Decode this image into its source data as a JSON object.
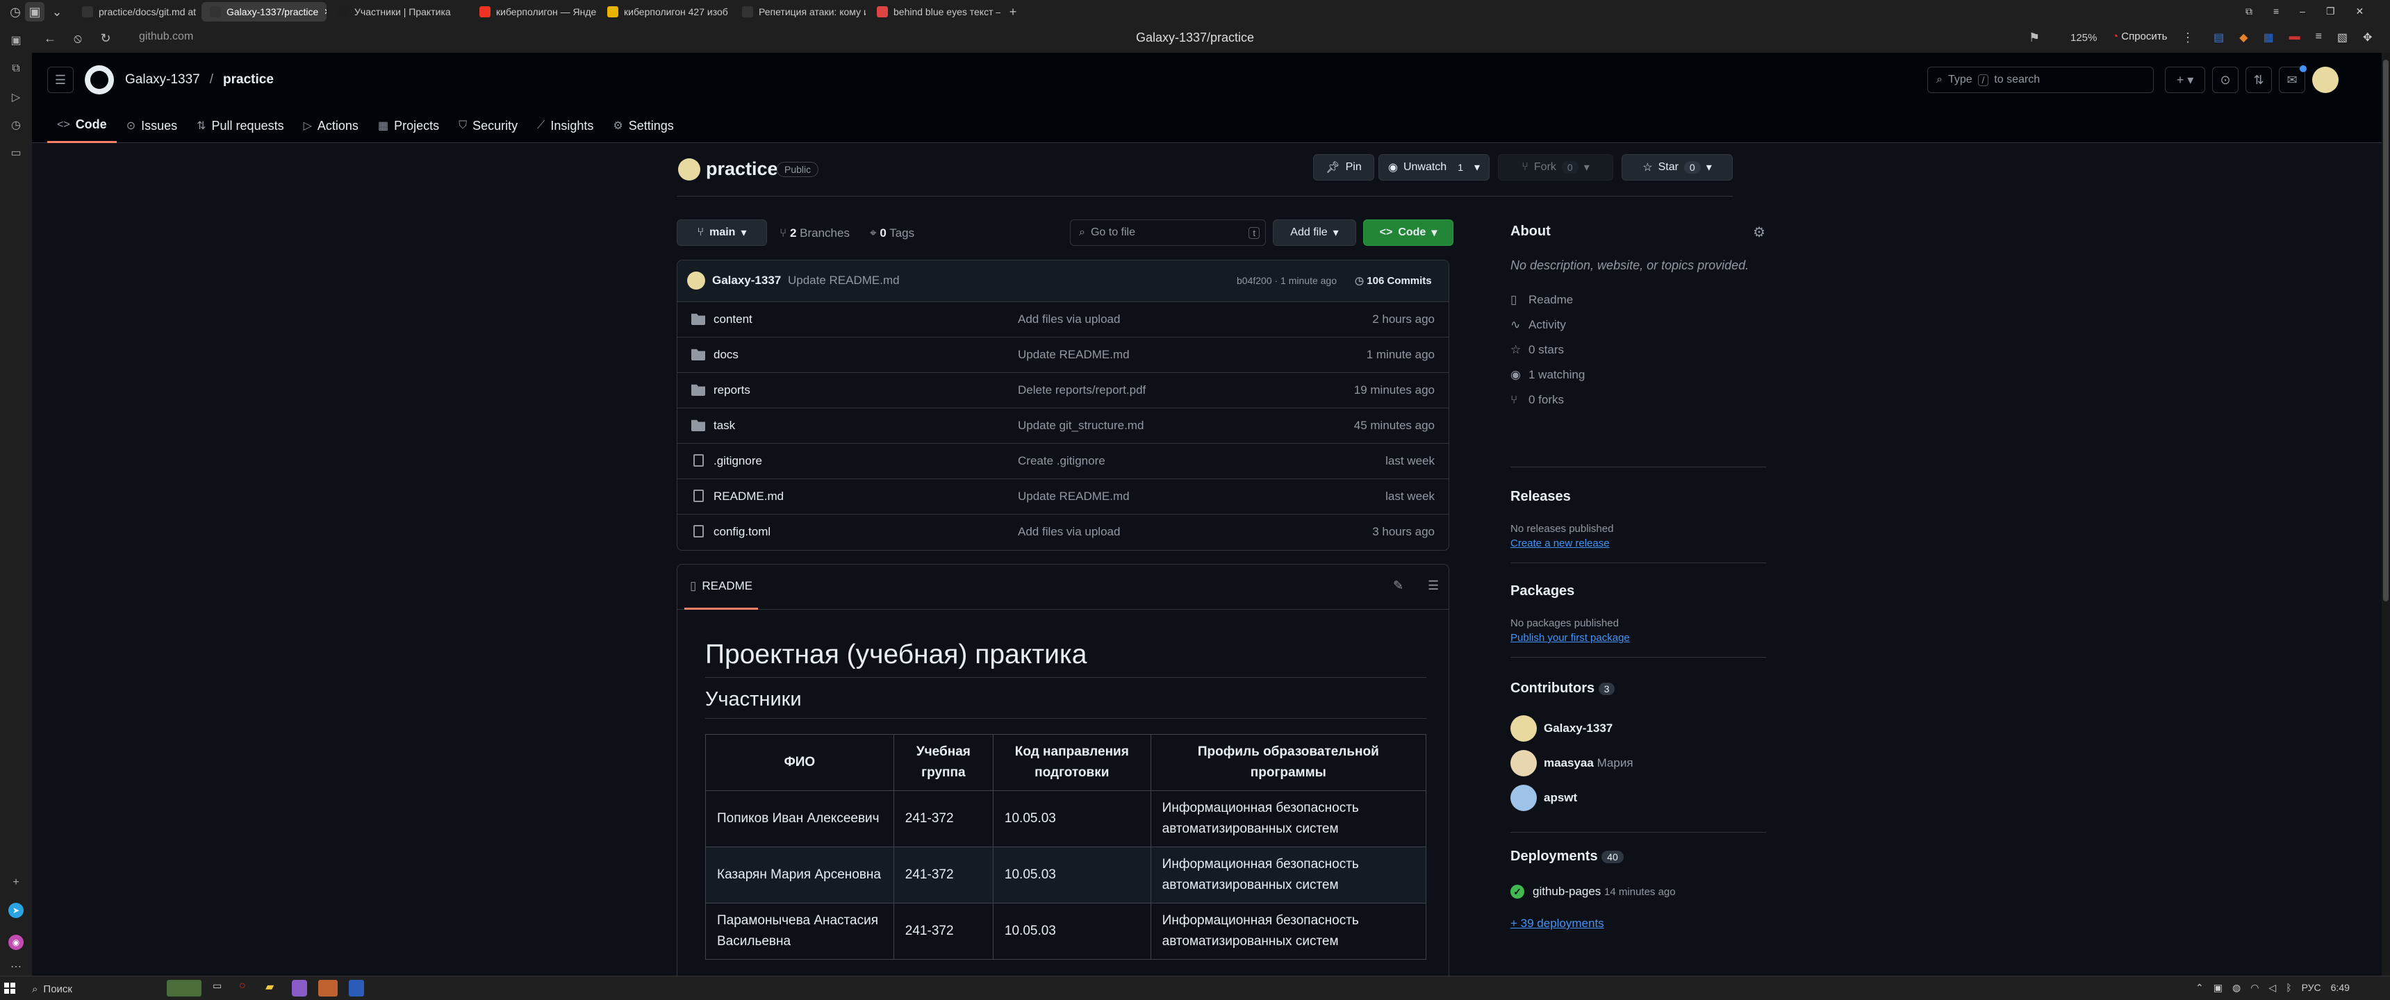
{
  "browser": {
    "tabs": [
      {
        "label": "practice/docs/git.md at m",
        "color": "#333"
      },
      {
        "label": "Galaxy-1337/practice",
        "color": "#333",
        "active": true
      },
      {
        "label": "Участники | Практика",
        "color": "#1e1e1e"
      },
      {
        "label": "киберполигон — Яндекс",
        "color": "#e32"
      },
      {
        "label": "киберполигон 427 изоб",
        "color": "#e9b400"
      },
      {
        "label": "Репетиция атаки: кому и",
        "color": "#333"
      },
      {
        "label": "behind blue eyes текст —",
        "color": "#d44"
      }
    ],
    "url": "github.com",
    "page_title": "Galaxy-1337/practice",
    "zoom": "125%",
    "ask_label": "Спросить"
  },
  "header": {
    "owner": "Galaxy-1337",
    "sep": "/",
    "repo": "practice",
    "search_placeholder": "Type / to search",
    "search_type": "Type",
    "search_key": "/",
    "search_rest": "to search"
  },
  "repo_nav": [
    {
      "label": "Code",
      "icon": "code-icon",
      "active": true
    },
    {
      "label": "Issues",
      "icon": "issue-icon"
    },
    {
      "label": "Pull requests",
      "icon": "pull-request-icon"
    },
    {
      "label": "Actions",
      "icon": "actions-icon"
    },
    {
      "label": "Projects",
      "icon": "projects-icon"
    },
    {
      "label": "Security",
      "icon": "shield-icon"
    },
    {
      "label": "Insights",
      "icon": "graph-icon"
    },
    {
      "label": "Settings",
      "icon": "gear-icon"
    }
  ],
  "repo": {
    "name": "practice",
    "visibility": "Public",
    "pin": "Pin",
    "unwatch": "Unwatch",
    "watch_count": "1",
    "fork": "Fork",
    "fork_count": "0",
    "star": "Star",
    "star_count": "0"
  },
  "toolbar": {
    "branch": "main",
    "branches_count": "2",
    "branches_label": "Branches",
    "tags_count": "0",
    "tags_label": "Tags",
    "goto_placeholder": "Go to file",
    "goto_key": "t",
    "add_file": "Add file",
    "code": "Code"
  },
  "commit": {
    "author": "Galaxy-1337",
    "message": "Update README.md",
    "hash_time": "b04f200 · 1 minute ago",
    "commits": "106 Commits"
  },
  "files": [
    {
      "name": "content",
      "type": "dir",
      "message": "Add files via upload",
      "time": "2 hours ago"
    },
    {
      "name": "docs",
      "type": "dir",
      "message": "Update README.md",
      "time": "1 minute ago"
    },
    {
      "name": "reports",
      "type": "dir",
      "message": "Delete reports/report.pdf",
      "time": "19 minutes ago"
    },
    {
      "name": "task",
      "type": "dir",
      "message": "Update git_structure.md",
      "time": "45 minutes ago"
    },
    {
      "name": ".gitignore",
      "type": "file",
      "message": "Create .gitignore",
      "time": "last week"
    },
    {
      "name": "README.md",
      "type": "file",
      "message": "Update README.md",
      "time": "last week"
    },
    {
      "name": "config.toml",
      "type": "file",
      "message": "Add files via upload",
      "time": "3 hours ago"
    }
  ],
  "readme": {
    "tab": "README",
    "h1": "Проектная (учебная) практика",
    "h2": "Участники",
    "columns": [
      "ФИО",
      "Учебная группа",
      "Код направления подготовки",
      "Профиль образовательной программы"
    ],
    "rows": [
      [
        "Попиков Иван Алексеевич",
        "241-372",
        "10.05.03",
        "Информационная безопасность автоматизированных систем"
      ],
      [
        "Казарян Мария Арсеновна",
        "241-372",
        "10.05.03",
        "Информационная безопасность автоматизированных систем"
      ],
      [
        "Парамонычева Анастасия Васильевна",
        "241-372",
        "10.05.03",
        "Информационная безопасность автоматизированных систем"
      ]
    ]
  },
  "about": {
    "title": "About",
    "description": "No description, website, or topics provided.",
    "items": [
      {
        "label": "Readme",
        "icon": "book-icon"
      },
      {
        "label": "Activity",
        "icon": "pulse-icon"
      },
      {
        "label": "0 stars",
        "icon": "star-icon"
      },
      {
        "label": "1 watching",
        "icon": "eye-icon"
      },
      {
        "label": "0 forks",
        "icon": "fork-icon"
      }
    ]
  },
  "releases": {
    "title": "Releases",
    "none": "No releases published",
    "link": "Create a new release"
  },
  "packages": {
    "title": "Packages",
    "none": "No packages published",
    "link": "Publish your first package"
  },
  "contributors": {
    "title": "Contributors",
    "count": "3",
    "list": [
      {
        "login": "Galaxy-1337",
        "name": "",
        "color": "#e8d9a0"
      },
      {
        "login": "maasyaa",
        "name": "Мария",
        "color": "#e8d6b0"
      },
      {
        "login": "apswt",
        "name": "",
        "color": "#9fc3e8"
      }
    ]
  },
  "deployments": {
    "title": "Deployments",
    "count": "40",
    "env": "github-pages",
    "time": "14 minutes ago",
    "more": "+ 39 deployments",
    "success_color": "#3fb950"
  },
  "taskbar": {
    "search": "Поиск",
    "lang": "РУС",
    "time": "6:49"
  },
  "colors": {
    "accent": "#f78166",
    "green_button": "#238636",
    "link": "#4493f8"
  }
}
